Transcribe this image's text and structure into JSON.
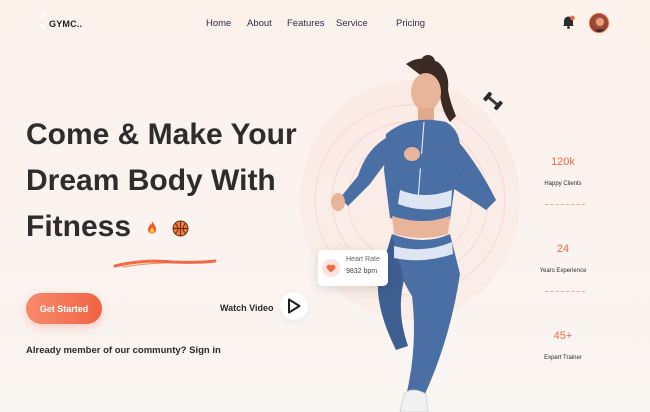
{
  "header": {
    "brand": "GYMC..",
    "nav": [
      {
        "label": "Home"
      },
      {
        "label": "About"
      },
      {
        "label": "Features"
      },
      {
        "label": "Service"
      },
      {
        "label": "Pricing"
      }
    ],
    "icons": [
      "logo-icon",
      "bell-icon",
      "avatar"
    ]
  },
  "hero": {
    "line1": "Come & Make Your",
    "line2": "Dream Body With",
    "line3": "Fitness",
    "emojis": [
      "fire-icon",
      "basketball-icon"
    ],
    "cta_label": "Get Started",
    "watch_label": "Watch Video",
    "member_text": "Already member of our communty?",
    "signin_label": "Sign in"
  },
  "heart_card": {
    "label": "Heart Rate",
    "value": "9832 bpm"
  },
  "stats": [
    {
      "value": "120k",
      "label": "Happy Clients"
    },
    {
      "value": "24",
      "label": "Years Experience"
    },
    {
      "value": "45+",
      "label": "Expert Trainer"
    }
  ],
  "colors": {
    "accent": "#f06a45",
    "accent_light": "#f88a6c",
    "heading": "#2d2d2d",
    "nav": "#2b2f4a",
    "outfit_blue": "#4a6fa5"
  }
}
